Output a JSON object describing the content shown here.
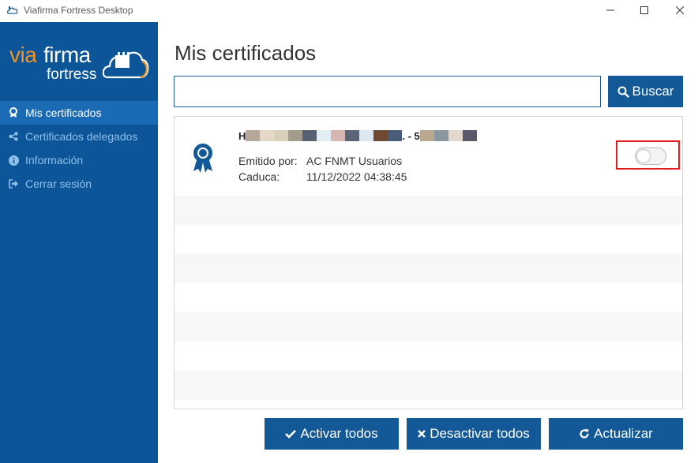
{
  "window": {
    "title": "Viafirma Fortress Desktop"
  },
  "logo": {
    "via": "via",
    "firma": "firma",
    "fortress": "fortress"
  },
  "sidebar": {
    "items": [
      {
        "label": "Mis certificados",
        "icon": "ribbon-icon",
        "active": true
      },
      {
        "label": "Certificados delegados",
        "icon": "share-icon",
        "active": false
      },
      {
        "label": "Información",
        "icon": "info-icon",
        "active": false
      },
      {
        "label": "Cerrar sesión",
        "icon": "sign-out-icon",
        "active": false
      }
    ]
  },
  "main": {
    "title": "Mis certificados",
    "search": {
      "value": "",
      "button_label": "Buscar"
    },
    "certificates": [
      {
        "name_prefix": "H",
        "name_middle": ". - 5",
        "issuer_label": "Emitido por:",
        "issuer_value": "AC FNMT Usuarios",
        "expiry_label": "Caduca:",
        "expiry_value": "11/12/2022 04:38:45",
        "active": false
      }
    ],
    "buttons": {
      "activate_all": "Activar todos",
      "deactivate_all": "Desactivar todos",
      "refresh": "Actualizar"
    }
  },
  "colors": {
    "sidebar_bg": "#0c5599",
    "sidebar_active": "#1a6bb3",
    "button_bg": "#145997",
    "brand_orange": "#f19325",
    "highlight_red": "#e01e1e"
  }
}
